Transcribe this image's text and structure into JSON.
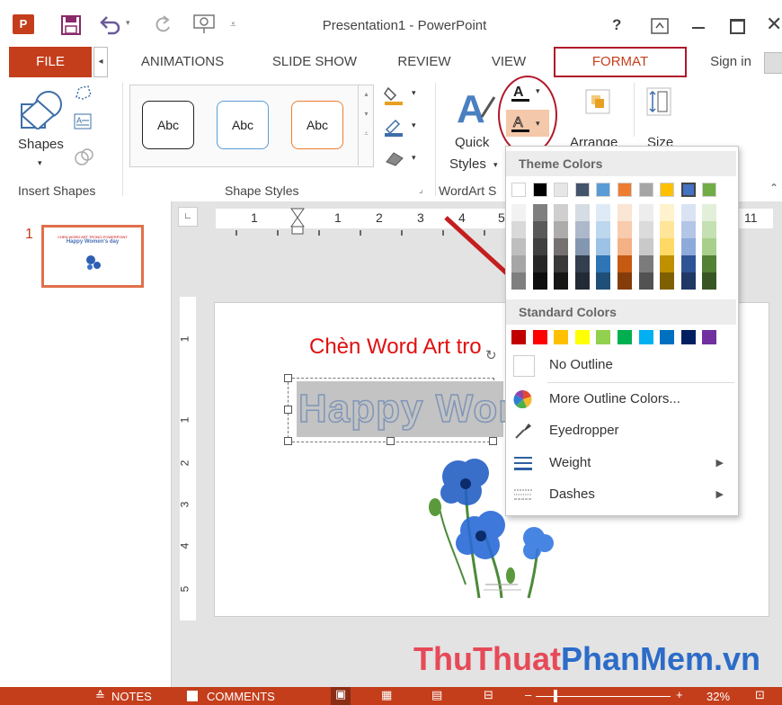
{
  "window": {
    "title": "Presentation1 - PowerPoint",
    "help": "?",
    "app_icon_label": "P"
  },
  "tabs": {
    "file": "FILE",
    "items": [
      "ANIMATIONS",
      "SLIDE SHOW",
      "REVIEW",
      "VIEW",
      "FORMAT"
    ],
    "sign_in": "Sign in"
  },
  "ribbon": {
    "insert_shapes": {
      "shapes_label": "Shapes",
      "group_label": "Insert Shapes"
    },
    "shape_styles": {
      "styles": [
        "Abc",
        "Abc",
        "Abc"
      ],
      "group_label": "Shape Styles"
    },
    "wordart": {
      "quick_label": "Quick",
      "styles_label": "Styles",
      "group_label": "WordArt S"
    },
    "arrange_label": "Arrange",
    "size_label": "Size"
  },
  "ruler": {
    "numbers": [
      "1",
      "1",
      "2",
      "3",
      "4",
      "5",
      "11"
    ]
  },
  "vruler": {
    "numbers": [
      "1",
      "1",
      "2",
      "3",
      "4",
      "5"
    ]
  },
  "thumbnail": {
    "number": "1",
    "title": "CHEN WORD ART TRONG POWERPOINT",
    "subtitle": "Happy Women's day"
  },
  "slide": {
    "heading": "Chèn Word Art tro",
    "wordart_text": "Happy Wor"
  },
  "dropdown": {
    "theme_header": "Theme Colors",
    "standard_header": "Standard Colors",
    "no_outline": "No Outline",
    "more_colors": "More Outline Colors...",
    "eyedropper": "Eyedropper",
    "weight": "Weight",
    "dashes": "Dashes",
    "theme_top": [
      "#ffffff",
      "#000000",
      "#e7e6e6",
      "#44546a",
      "#5b9bd5",
      "#ed7d31",
      "#a5a5a5",
      "#ffc000",
      "#4472c4",
      "#70ad47"
    ],
    "theme_columns": [
      [
        "#f2f2f2",
        "#d9d9d9",
        "#bfbfbf",
        "#a6a6a6",
        "#7f7f7f"
      ],
      [
        "#7f7f7f",
        "#595959",
        "#404040",
        "#262626",
        "#0d0d0d"
      ],
      [
        "#d0cece",
        "#aeabab",
        "#757171",
        "#3a3838",
        "#171616"
      ],
      [
        "#d6dce4",
        "#adb9ca",
        "#8497b0",
        "#333f4f",
        "#222a35"
      ],
      [
        "#deebf6",
        "#bdd7ee",
        "#9cc3e5",
        "#2e75b5",
        "#1f4e79"
      ],
      [
        "#fbe5d5",
        "#f7cbac",
        "#f4b183",
        "#c55a11",
        "#843c0b"
      ],
      [
        "#ededed",
        "#dbdbdb",
        "#c9c9c9",
        "#7b7b7b",
        "#525252"
      ],
      [
        "#fff2cc",
        "#fee599",
        "#ffd965",
        "#bf9000",
        "#7f6000"
      ],
      [
        "#dae3f3",
        "#b4c6e7",
        "#8eaadb",
        "#2f5496",
        "#1f3864"
      ],
      [
        "#e2efd9",
        "#c5e0b3",
        "#a8d08d",
        "#538135",
        "#375623"
      ]
    ],
    "standard": [
      "#c00000",
      "#ff0000",
      "#ffc000",
      "#ffff00",
      "#92d050",
      "#00b050",
      "#00b0f0",
      "#0070c0",
      "#002060",
      "#7030a0"
    ]
  },
  "status": {
    "notes": "NOTES",
    "comments": "COMMENTS",
    "zoom": "32%"
  },
  "watermark": {
    "part1": "ThuThuat",
    "part2": "PhanMem",
    "part3": ".vn"
  },
  "colors": {
    "accent": "#c43e1c",
    "annotation_red": "#b0182a",
    "wordart_blue": "#7f95b8"
  }
}
